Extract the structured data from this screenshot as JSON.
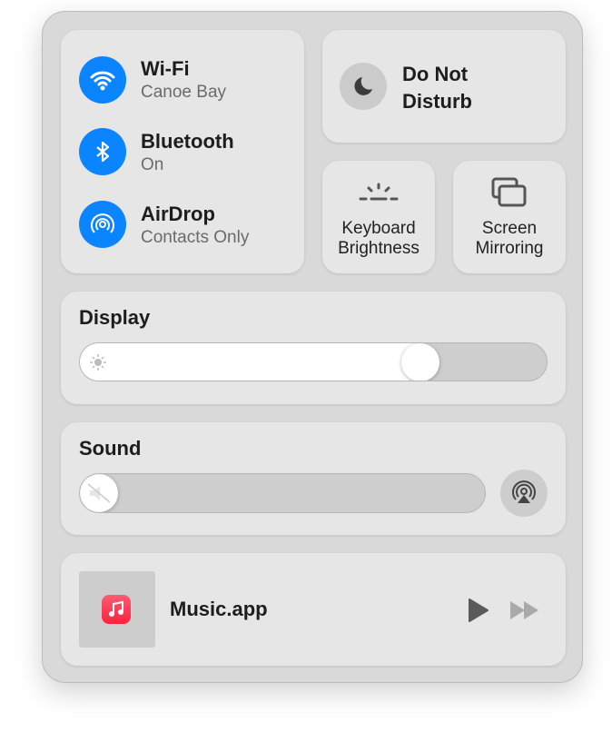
{
  "connectivity": [
    {
      "title": "Wi-Fi",
      "subtitle": "Canoe Bay",
      "icon": "wifi-icon"
    },
    {
      "title": "Bluetooth",
      "subtitle": "On",
      "icon": "bluetooth-icon"
    },
    {
      "title": "AirDrop",
      "subtitle": "Contacts Only",
      "icon": "airdrop-icon"
    }
  ],
  "dnd": {
    "line1": "Do Not",
    "line2": "Disturb",
    "icon": "moon-icon"
  },
  "keyboard": {
    "line1": "Keyboard",
    "line2": "Brightness",
    "icon": "keyboard-brightness-icon"
  },
  "mirroring": {
    "line1": "Screen",
    "line2": "Mirroring",
    "icon": "screen-mirroring-icon"
  },
  "display": {
    "label": "Display",
    "brightness": 0.75
  },
  "sound": {
    "label": "Sound",
    "volume": 0.0
  },
  "music": {
    "title": "Music.app"
  },
  "colors": {
    "accent": "#0a84ff",
    "music": "#fa2d48"
  }
}
